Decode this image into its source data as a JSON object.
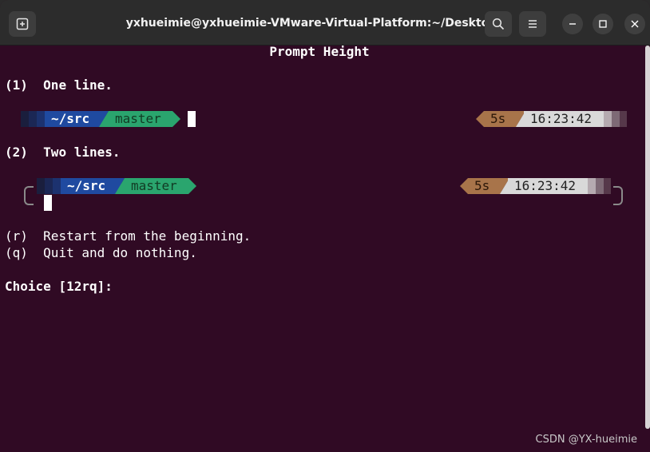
{
  "window": {
    "title": "yxhueimie@yxhueimie-VMware-Virtual-Platform:~/Desktop"
  },
  "terminal": {
    "heading": "Prompt Height",
    "option1": {
      "key": "(1)",
      "label": "One line."
    },
    "option2": {
      "key": "(2)",
      "label": "Two lines."
    },
    "prompt": {
      "dir": "~/src",
      "branch": "master",
      "duration": "5s",
      "time": "16:23:42"
    },
    "restart": {
      "key": "(r)",
      "label": "Restart from the beginning."
    },
    "quit": {
      "key": "(q)",
      "label": "Quit and do nothing."
    },
    "choice": "Choice [12rq]:"
  },
  "colors": {
    "terminal_bg": "#300a24",
    "dir_segment": "#1f4aa0",
    "branch_segment": "#2aa56e",
    "duration_segment": "#a8744a",
    "time_segment": "#d9d9d9"
  },
  "icons": {
    "new_tab": "new-tab-icon",
    "search": "search-icon",
    "menu": "hamburger-menu-icon",
    "minimize": "minimize-icon",
    "maximize": "maximize-icon",
    "close": "close-icon"
  },
  "watermark": "CSDN @YX-hueimie"
}
